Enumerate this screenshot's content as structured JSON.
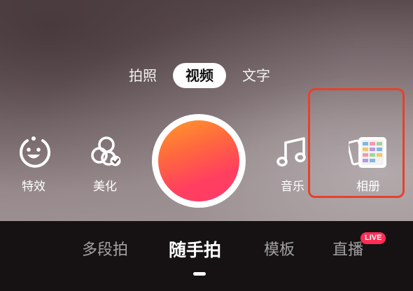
{
  "mode_tabs": [
    {
      "label": "拍照",
      "selected": false
    },
    {
      "label": "视频",
      "selected": true
    },
    {
      "label": "文字",
      "selected": false
    }
  ],
  "tools": {
    "effects": {
      "label": "特效",
      "icon": "smiley-face-icon"
    },
    "beauty": {
      "label": "美化",
      "icon": "beauty-circles-icon"
    },
    "music": {
      "label": "音乐",
      "icon": "music-note-icon"
    },
    "album": {
      "label": "相册",
      "icon": "photo-album-icon"
    }
  },
  "record_button": {
    "icon": "record-circle"
  },
  "bottom_tabs": [
    {
      "label": "多段拍",
      "active": false
    },
    {
      "label": "随手拍",
      "active": true
    },
    {
      "label": "模板",
      "active": false
    },
    {
      "label": "直播",
      "active": false,
      "badge": "LIVE"
    }
  ],
  "colors": {
    "record_gradient_start": "#ff9a2a",
    "record_gradient_end": "#ff3a6a",
    "highlight": "#e8402c",
    "live_badge": "#ff2d55"
  }
}
